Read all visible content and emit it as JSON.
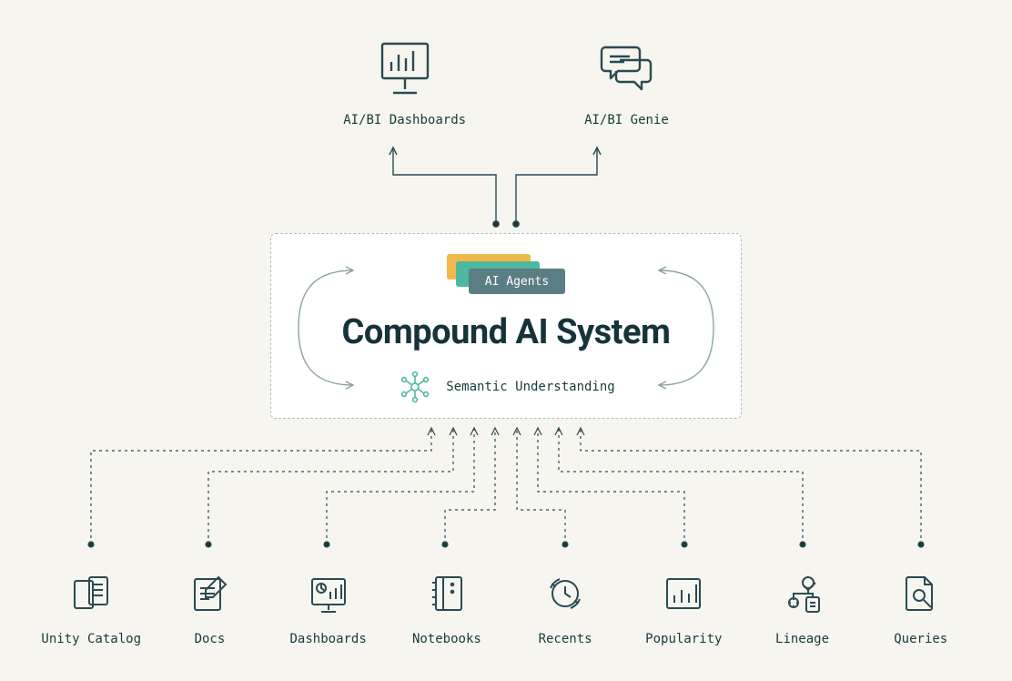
{
  "top": [
    {
      "label": "AI/BI Dashboards",
      "icon": "monitor-bars-icon"
    },
    {
      "label": "AI/BI Genie",
      "icon": "chat-bubbles-icon"
    }
  ],
  "center": {
    "agents_label": "AI Agents",
    "title": "Compound AI System",
    "semantic_label": "Semantic Understanding"
  },
  "bottom": [
    {
      "label": "Unity Catalog",
      "icon": "catalog-icon"
    },
    {
      "label": "Docs",
      "icon": "docs-icon"
    },
    {
      "label": "Dashboards",
      "icon": "dashboard-icon"
    },
    {
      "label": "Notebooks",
      "icon": "notebook-icon"
    },
    {
      "label": "Recents",
      "icon": "recents-icon"
    },
    {
      "label": "Popularity",
      "icon": "popularity-icon"
    },
    {
      "label": "Lineage",
      "icon": "lineage-icon"
    },
    {
      "label": "Queries",
      "icon": "queries-icon"
    }
  ],
  "colors": {
    "stroke": "#2b4a52",
    "bg": "#f6f5f0",
    "accentYellow": "#f1b94a",
    "accentTeal": "#4fb8a0",
    "accentSlate": "#5a7e84"
  }
}
